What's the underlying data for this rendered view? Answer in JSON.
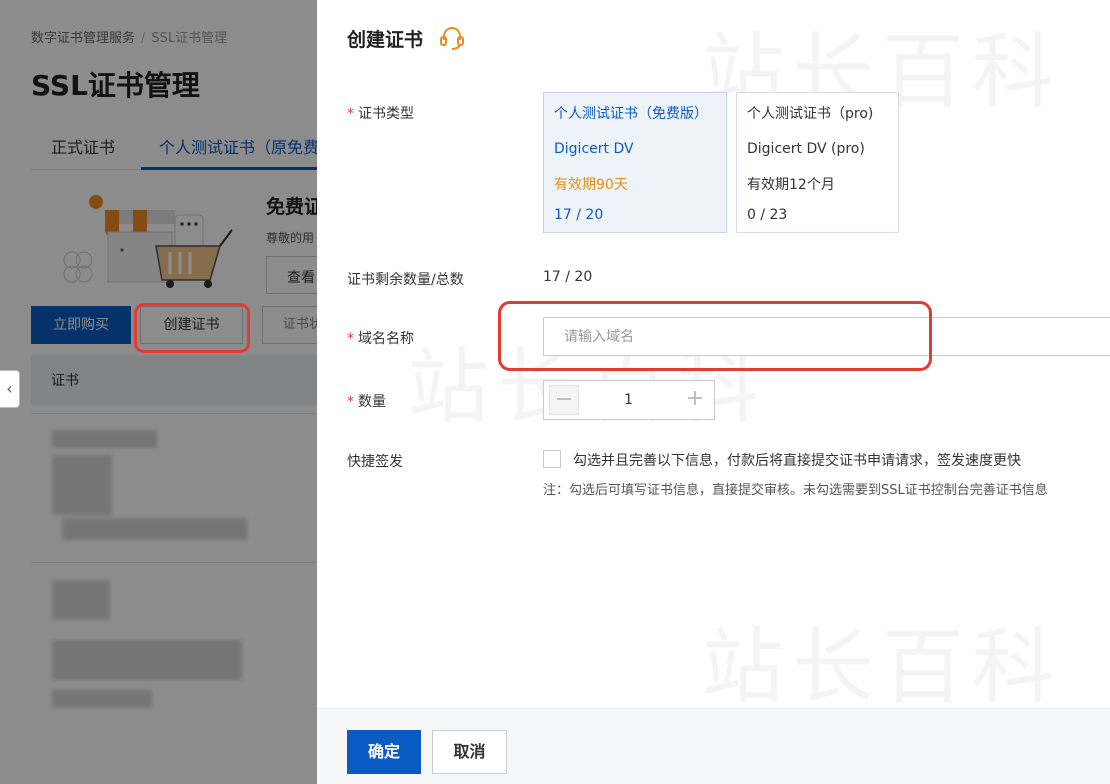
{
  "background": {
    "breadcrumb": {
      "parent": "数字证书管理服务",
      "separator": "/",
      "current": "SSL证书管理"
    },
    "title": "SSL证书管理",
    "tabs": [
      {
        "label": "正式证书"
      },
      {
        "label": "个人测试证书（原免费"
      }
    ],
    "promo": {
      "title": "免费证",
      "subtitle": "尊敬的用",
      "button": "查看"
    },
    "buttons": {
      "buy": "立即购买",
      "create": "创建证书",
      "more": "证书状"
    },
    "table": {
      "header": "证书"
    }
  },
  "drawer": {
    "title": "创建证书",
    "cert_type": {
      "label": "证书类型",
      "options": [
        {
          "name": "个人测试证书（免费版）",
          "type": "Digicert DV",
          "validity": "有效期90天",
          "count": "17 / 20",
          "selected": true
        },
        {
          "name": "个人测试证书（pro)",
          "type": "Digicert DV (pro)",
          "validity": "有效期12个月",
          "count": "0 / 23",
          "selected": false
        }
      ]
    },
    "remaining": {
      "label": "证书剩余数量/总数",
      "value": "17 / 20"
    },
    "domain": {
      "label": "域名名称",
      "placeholder": "请输入域名",
      "value": ""
    },
    "quantity": {
      "label": "数量",
      "value": "1",
      "minus": "−",
      "plus": "+"
    },
    "quick_issue": {
      "label": "快捷签发",
      "checkbox_text": "勾选并且完善以下信息，付款后将直接提交证书申请请求，签发速度更快",
      "note": "注：勾选后可填写证书信息，直接提交审核。未勾选需要到SSL证书控制台完善证书信息",
      "checked": false
    },
    "footer": {
      "confirm": "确定",
      "cancel": "取消"
    }
  },
  "watermark": "站长百科",
  "colors": {
    "primary": "#0a5bc4",
    "warning": "#e58f12",
    "required": "#e43a34",
    "highlight_circle": "#e43a34"
  }
}
